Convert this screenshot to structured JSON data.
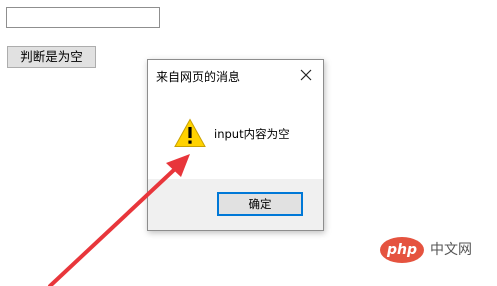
{
  "page": {
    "input_value": "",
    "check_button_label": "判断是为空"
  },
  "dialog": {
    "title": "来自网页的消息",
    "close_glyph": "✕",
    "icon": "warning-icon",
    "message": "input内容为空",
    "ok_label": "确定",
    "accent_color": "#0078d7"
  },
  "annotation": {
    "arrow_color": "#e8363b"
  },
  "watermark": {
    "logo_text": "php",
    "site_text": "中文网",
    "logo_color": "#e5533f"
  }
}
